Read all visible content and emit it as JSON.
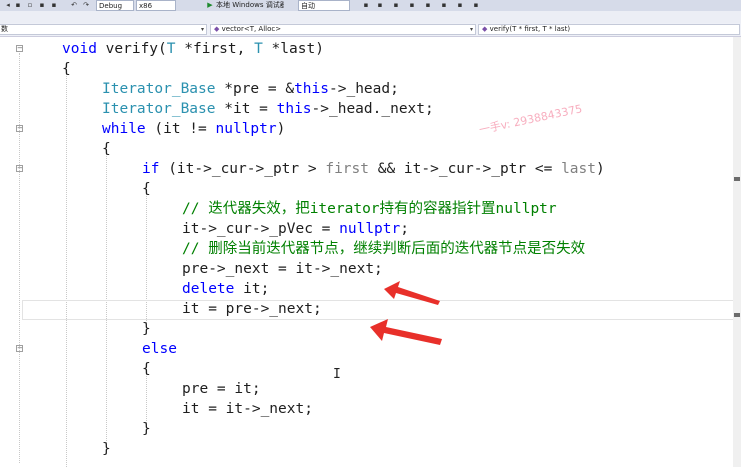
{
  "toolbar": {
    "config": "Debug",
    "platform": "x86",
    "run_label": "本地 Windows 调试器",
    "mode": "自动"
  },
  "nav": {
    "project": "数",
    "scope": "vector<T, Alloc>",
    "member": "verify(T * first, T * last)"
  },
  "code": {
    "l1": [
      "void",
      " verify(",
      "T",
      " *first, ",
      "T",
      " *last)"
    ],
    "l2": "{",
    "l3": [
      "Iterator_Base",
      " *pre = &",
      "this",
      "->_head;"
    ],
    "l4": [
      "Iterator_Base",
      " *it = ",
      "this",
      "->_head._next;"
    ],
    "l5": [
      "while",
      " (it != ",
      "nullptr",
      ")"
    ],
    "l6": "{",
    "l7": [
      "if",
      " (it->_cur->_ptr > ",
      "first",
      " && it->_cur->_ptr <= ",
      "last",
      ")"
    ],
    "l8": "{",
    "l9": "// 迭代器失效，把iterator持有的容器指针置nullptr",
    "l10": [
      "it->_cur->_pVec = ",
      "nullptr",
      ";"
    ],
    "l11": "// 删除当前迭代器节点，继续判断后面的迭代器节点是否失效",
    "l12": "pre->_next = it->_next;",
    "l13": [
      "delete",
      " it;"
    ],
    "l14": "it = pre->_next;",
    "l15": "}",
    "l16": "else",
    "l17": "{",
    "l18": "pre = it;",
    "l19": "it = it->_next;",
    "l20": "}",
    "l21": "}"
  },
  "watermark": {
    "qq": "一手v: 2938843375"
  },
  "colors": {
    "keyword": "#0000ff",
    "type": "#2b91af",
    "comment": "#008000",
    "annotation_arrow": "#e8302a"
  }
}
